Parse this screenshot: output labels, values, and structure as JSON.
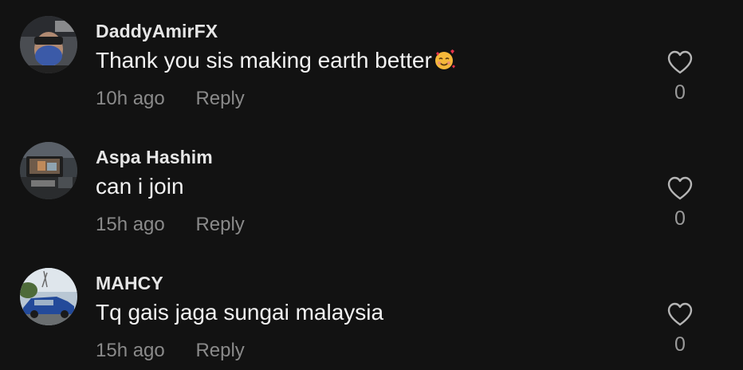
{
  "comments": [
    {
      "username": "DaddyAmirFX",
      "text": "Thank you sis making earth better",
      "emoji": "smiling-face-with-hearts-emoji",
      "time": "10h ago",
      "reply_label": "Reply",
      "likes": "0"
    },
    {
      "username": "Aspa Hashim",
      "text": "can i join",
      "time": "15h ago",
      "reply_label": "Reply",
      "likes": "0"
    },
    {
      "username": "MAHCY",
      "text": "Tq gais jaga sungai malaysia",
      "time": "15h ago",
      "reply_label": "Reply",
      "likes": "0"
    }
  ],
  "icons": {
    "like": "heart-outline-icon"
  },
  "colors": {
    "background": "#121212",
    "text": "#f2f2f2",
    "muted": "#8a8a8a",
    "accent_emoji": "#f5b83a"
  }
}
